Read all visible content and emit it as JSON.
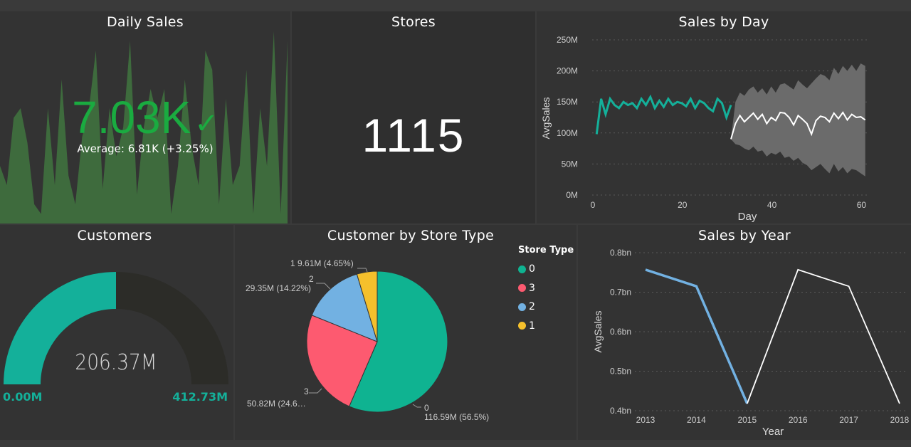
{
  "kpi_daily": {
    "title": "Daily Sales",
    "value": "7.03K",
    "check": "✓",
    "average_text": "Average: 6.81K (+3.25%)",
    "trend": [
      0.3,
      0.2,
      0.55,
      0.6,
      0.42,
      0.1,
      0.05,
      0.6,
      0.2,
      0.75,
      0.25,
      0.1,
      0.45,
      0.6,
      0.9,
      0.18,
      0.6,
      0.35,
      0.5,
      0.95,
      0.15,
      0.5,
      0.7,
      0.55,
      0.7,
      0.05,
      0.3,
      0.75,
      0.4,
      0.2,
      0.9,
      0.8,
      0.1,
      0.65,
      0.2,
      0.3,
      0.8,
      0.05,
      0.6,
      0.3,
      1.0,
      0.05,
      0.95
    ],
    "fill_color": "#3e6b3d",
    "value_color": "#1aab40"
  },
  "kpi_stores": {
    "title": "Stores",
    "value": "1115"
  },
  "sales_by_day": {
    "title": "Sales by Day",
    "ylabel": "AvgSales",
    "xlabel": "Day",
    "y_ticks": [
      "250M",
      "200M",
      "150M",
      "100M",
      "50M",
      "0M"
    ],
    "x_ticks": [
      "0",
      "20",
      "40",
      "60"
    ]
  },
  "customers_gauge": {
    "title": "Customers",
    "value": "206.37M",
    "min_label": "0.00M",
    "max_label": "412.73M",
    "fraction": 0.5,
    "fill_color": "#14b09a",
    "track_color": "#2c2c28"
  },
  "customer_by_store_type": {
    "title": "Customer by Store Type",
    "legend_title": "Store Type",
    "legend_items": [
      {
        "label": "0",
        "color": "#0fb391"
      },
      {
        "label": "3",
        "color": "#fd5a70"
      },
      {
        "label": "2",
        "color": "#72b1e2"
      },
      {
        "label": "1",
        "color": "#f5c02c"
      }
    ],
    "slice_labels": {
      "s1": "1 9.61M (4.65%)",
      "s2_name": "2",
      "s2_value": "29.35M (14.22%)",
      "s3_name": "3",
      "s3_value": "50.82M (24.6…",
      "s0_name": "0",
      "s0_value": "116.59M (56.5%)"
    }
  },
  "sales_by_year": {
    "title": "Sales by Year",
    "ylabel": "AvgSales",
    "xlabel": "Year",
    "y_ticks": [
      "0.8bn",
      "0.7bn",
      "0.6bn",
      "0.5bn",
      "0.4bn"
    ],
    "x_ticks": [
      "2013",
      "2014",
      "2015",
      "2016",
      "2017",
      "2018"
    ]
  },
  "chart_data": [
    {
      "type": "line",
      "title": "Sales by Day",
      "xlabel": "Day",
      "ylabel": "AvgSales",
      "ylim": [
        0,
        250000000
      ],
      "xlim": [
        0,
        62
      ],
      "grid": true,
      "series": [
        {
          "x": [
            1,
            2,
            3,
            4,
            5,
            6,
            7,
            8,
            9,
            10,
            11,
            12,
            13,
            14,
            15,
            16,
            17,
            18,
            19,
            20,
            21,
            22,
            23,
            24,
            25,
            26,
            27,
            28,
            29,
            30,
            31
          ],
          "y": [
            98000000,
            155000000,
            130000000,
            155000000,
            145000000,
            140000000,
            150000000,
            145000000,
            148000000,
            140000000,
            155000000,
            145000000,
            158000000,
            140000000,
            152000000,
            142000000,
            155000000,
            145000000,
            150000000,
            148000000,
            143000000,
            155000000,
            140000000,
            152000000,
            148000000,
            140000000,
            135000000,
            155000000,
            148000000,
            125000000,
            145000000
          ],
          "color": "#14b09a"
        },
        {
          "x": [
            31,
            32,
            33,
            34,
            35,
            36,
            37,
            38,
            39,
            40,
            41,
            42,
            43,
            44,
            45,
            46,
            47,
            48,
            49,
            50,
            51,
            52,
            53,
            54,
            55,
            56,
            57,
            58,
            59,
            60,
            61
          ],
          "y": [
            90000000,
            115000000,
            128000000,
            118000000,
            125000000,
            132000000,
            122000000,
            130000000,
            115000000,
            125000000,
            120000000,
            133000000,
            132000000,
            125000000,
            113000000,
            128000000,
            122000000,
            115000000,
            98000000,
            120000000,
            127000000,
            125000000,
            118000000,
            132000000,
            123000000,
            133000000,
            121000000,
            130000000,
            125000000,
            126000000,
            121000000
          ],
          "color": "#ffffff"
        }
      ],
      "band": {
        "x": [
          31,
          32,
          33,
          34,
          35,
          36,
          37,
          38,
          39,
          40,
          41,
          42,
          43,
          44,
          45,
          46,
          47,
          48,
          49,
          50,
          51,
          52,
          53,
          54,
          55,
          56,
          57,
          58,
          59,
          60,
          61
        ],
        "upper": [
          90000000,
          150000000,
          165000000,
          160000000,
          170000000,
          175000000,
          165000000,
          172000000,
          162000000,
          175000000,
          165000000,
          178000000,
          180000000,
          175000000,
          170000000,
          185000000,
          178000000,
          172000000,
          180000000,
          188000000,
          195000000,
          192000000,
          185000000,
          205000000,
          195000000,
          208000000,
          200000000,
          210000000,
          200000000,
          212000000,
          208000000
        ],
        "lower": [
          90000000,
          82000000,
          80000000,
          75000000,
          72000000,
          78000000,
          70000000,
          72000000,
          62000000,
          68000000,
          65000000,
          70000000,
          60000000,
          62000000,
          55000000,
          60000000,
          52000000,
          48000000,
          40000000,
          45000000,
          50000000,
          42000000,
          35000000,
          50000000,
          38000000,
          45000000,
          35000000,
          42000000,
          40000000,
          35000000,
          30000000
        ],
        "color": "#6b6b6b"
      }
    },
    {
      "type": "pie",
      "title": "Customer by Store Type",
      "categories": [
        "0",
        "3",
        "2",
        "1"
      ],
      "values": [
        116590000,
        50820000,
        29350000,
        9610000
      ],
      "percent": [
        56.5,
        24.6,
        14.22,
        4.65
      ],
      "colors": [
        "#0fb391",
        "#fd5a70",
        "#72b1e2",
        "#f5c02c"
      ]
    },
    {
      "type": "line",
      "title": "Sales by Year",
      "xlabel": "Year",
      "ylabel": "AvgSales",
      "ylim": [
        0.4,
        0.8
      ],
      "categories": [
        "2013",
        "2014",
        "2015",
        "2016",
        "2017",
        "2018"
      ],
      "series": [
        {
          "x": [
            "2013",
            "2014",
            "2015"
          ],
          "y": [
            0.757,
            0.715,
            0.418
          ],
          "color": "#72b1e2"
        },
        {
          "x": [
            "2015",
            "2016",
            "2017",
            "2018"
          ],
          "y": [
            0.418,
            0.757,
            0.715,
            0.418
          ],
          "color": "#ffffff"
        }
      ]
    }
  ]
}
